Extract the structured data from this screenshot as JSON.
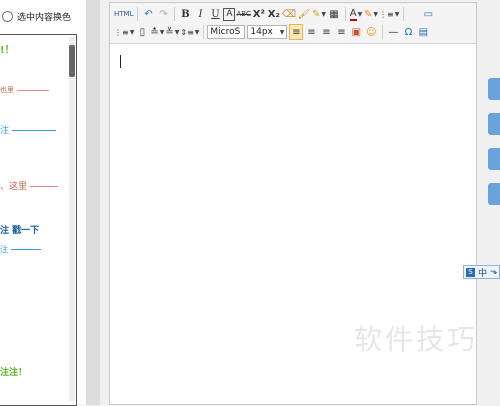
{
  "left_panel": {
    "radio_label": "选中内容换色",
    "preview_lines": [
      "!！",
      "也里",
      "注",
      "、这里",
      "注 戳一下",
      "注",
      "注注！"
    ]
  },
  "toolbar": {
    "html": "HTML",
    "undo": "↶",
    "redo": "↷",
    "bold": "B",
    "italic": "I",
    "underline": "U",
    "font_border": "A",
    "strikethrough": "ABC",
    "superscript": "X²",
    "subscript": "X₂",
    "eraser": "⌫",
    "format_painter": "🖌",
    "auto_format": "✎",
    "paste_plain": "▦",
    "font_color": "A",
    "background_color": "✎",
    "ordered_list": "⋮≡",
    "fullscreen": "▭",
    "unordered_list": "⋮≡",
    "page_break": "▯",
    "row_spacing_top": "≛",
    "row_spacing_bottom": "≚",
    "line_height": "⇕≡",
    "font_family": "MicroS",
    "font_size": "14px",
    "align_left": "≡",
    "align_center": "≡",
    "align_right": "≡",
    "justify": "≡",
    "image": "▣",
    "emoticon": "☺",
    "horizontal_rule": "—",
    "special_chars": "Ω",
    "table": "▤"
  },
  "ime": {
    "logo": "S",
    "mode": "中",
    "arrow": "⬎"
  },
  "watermark": "软件技巧"
}
